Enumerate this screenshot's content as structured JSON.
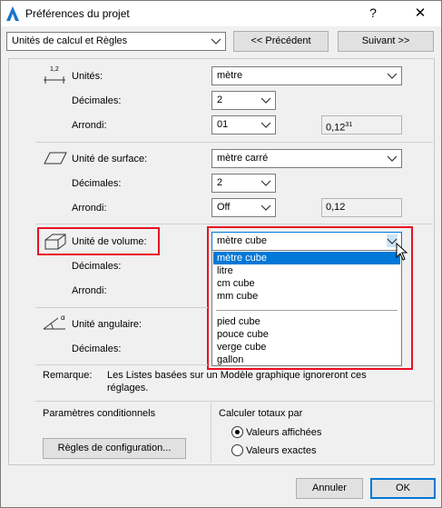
{
  "window": {
    "title": "Préférences du projet",
    "help": "?",
    "close": "✕"
  },
  "header": {
    "category_select": "Unités de calcul et Règles",
    "prev_button": "<< Précédent",
    "next_button": "Suivant >>"
  },
  "length": {
    "icon_caption": "1,2",
    "label": "Unités:",
    "unit": "mètre",
    "decimals_label": "Décimales:",
    "decimals": "2",
    "rounding_label": "Arrondi:",
    "rounding": "01",
    "preview": "0,12",
    "preview_sup": "31"
  },
  "area": {
    "label": "Unité de surface:",
    "unit": "mètre carré",
    "decimals_label": "Décimales:",
    "decimals": "2",
    "rounding_label": "Arrondi:",
    "rounding": "Off",
    "preview": "0,12"
  },
  "volume": {
    "label": "Unité de volume:",
    "unit": "mètre cube",
    "decimals_label": "Décimales:",
    "rounding_label": "Arrondi:",
    "options": [
      {
        "label": "mètre cube",
        "selected": true
      },
      {
        "label": "litre"
      },
      {
        "label": "cm cube"
      },
      {
        "label": "mm cube"
      },
      {
        "label": "pied cube"
      },
      {
        "label": "pouce cube"
      },
      {
        "label": "verge cube"
      },
      {
        "label": "gallon"
      }
    ]
  },
  "angle": {
    "label": "Unité angulaire:",
    "decimals_label": "Décimales:",
    "icon_caption": "α"
  },
  "remark": {
    "label": "Remarque:",
    "text_line1": "Les Listes basées sur un Modèle graphique ignoreront ces",
    "text_line2": "réglages."
  },
  "conditional": {
    "label": "Paramètres conditionnels",
    "config_button": "Règles de configuration..."
  },
  "totals": {
    "label": "Calculer totaux par",
    "option_displayed": "Valeurs affichées",
    "option_exact": "Valeurs exactes",
    "selected": "Valeurs affichées"
  },
  "footer": {
    "cancel": "Annuler",
    "ok": "OK"
  },
  "colors": {
    "highlight": "#e81123",
    "selection": "#0078d7"
  }
}
